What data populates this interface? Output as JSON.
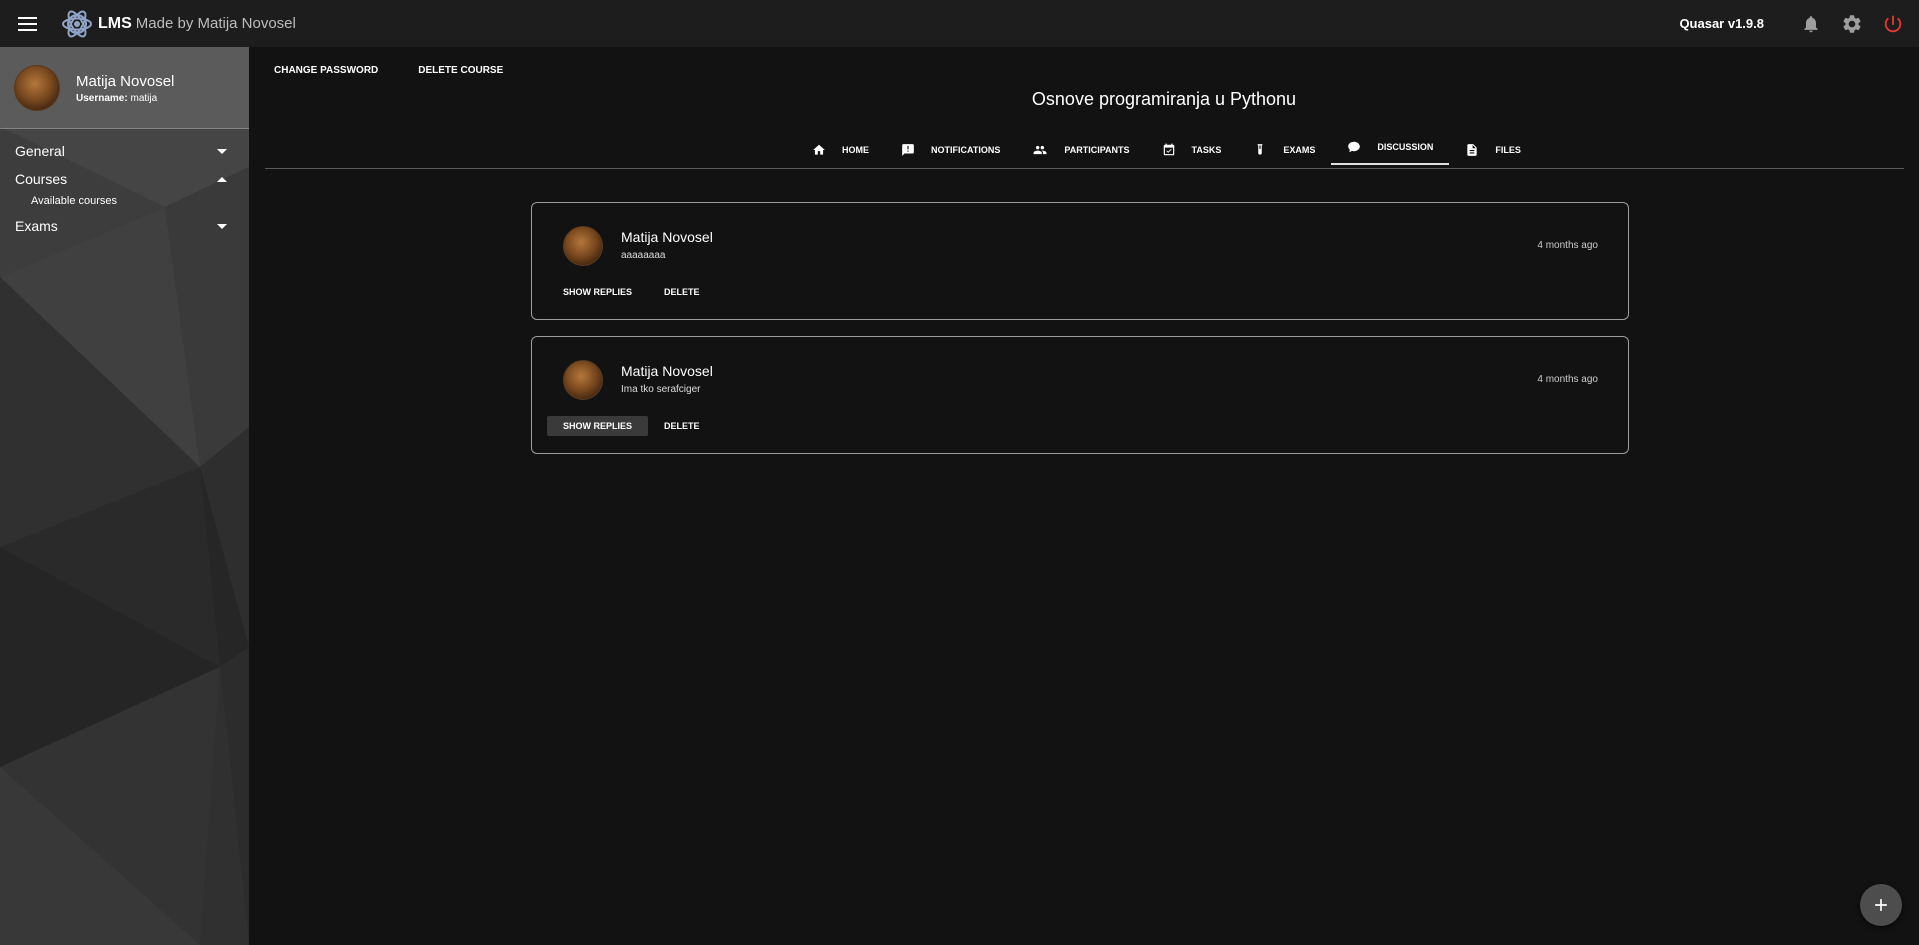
{
  "header": {
    "brand": "LMS",
    "brand_sub": "Made by Matija Novosel",
    "version": "Quasar v1.9.8",
    "icons": [
      "menu-icon",
      "atom-logo-icon",
      "bell-icon",
      "gear-icon",
      "power-icon"
    ],
    "power_color": "#e53935"
  },
  "sidebar": {
    "profile": {
      "name": "Matija Novosel",
      "username_label": "Username:",
      "username": "matija"
    },
    "items": [
      {
        "label": "General",
        "expanded": false
      },
      {
        "label": "Courses",
        "expanded": true,
        "children": [
          "Available courses"
        ]
      },
      {
        "label": "Exams",
        "expanded": false
      }
    ]
  },
  "main": {
    "actions": [
      "CHANGE PASSWORD",
      "DELETE COURSE"
    ],
    "course_title": "Osnove programiranja u Pythonu",
    "tabs": [
      {
        "label": "HOME",
        "icon": "home-icon"
      },
      {
        "label": "NOTIFICATIONS",
        "icon": "notification-icon"
      },
      {
        "label": "PARTICIPANTS",
        "icon": "people-icon"
      },
      {
        "label": "TASKS",
        "icon": "calendar-check-icon"
      },
      {
        "label": "EXAMS",
        "icon": "test-tube-icon"
      },
      {
        "label": "DISCUSSION",
        "icon": "chat-icon",
        "active": true
      },
      {
        "label": "FILES",
        "icon": "file-icon"
      }
    ],
    "posts": [
      {
        "author": "Matija Novosel",
        "text": "aaaaaaaa",
        "time": "4 months ago",
        "show_replies": "SHOW REPLIES",
        "delete": "DELETE"
      },
      {
        "author": "Matija Novosel",
        "text": "Ima tko serafciger",
        "time": "4 months ago",
        "show_replies": "SHOW REPLIES",
        "delete": "DELETE"
      }
    ],
    "fab_icon": "plus-icon"
  }
}
